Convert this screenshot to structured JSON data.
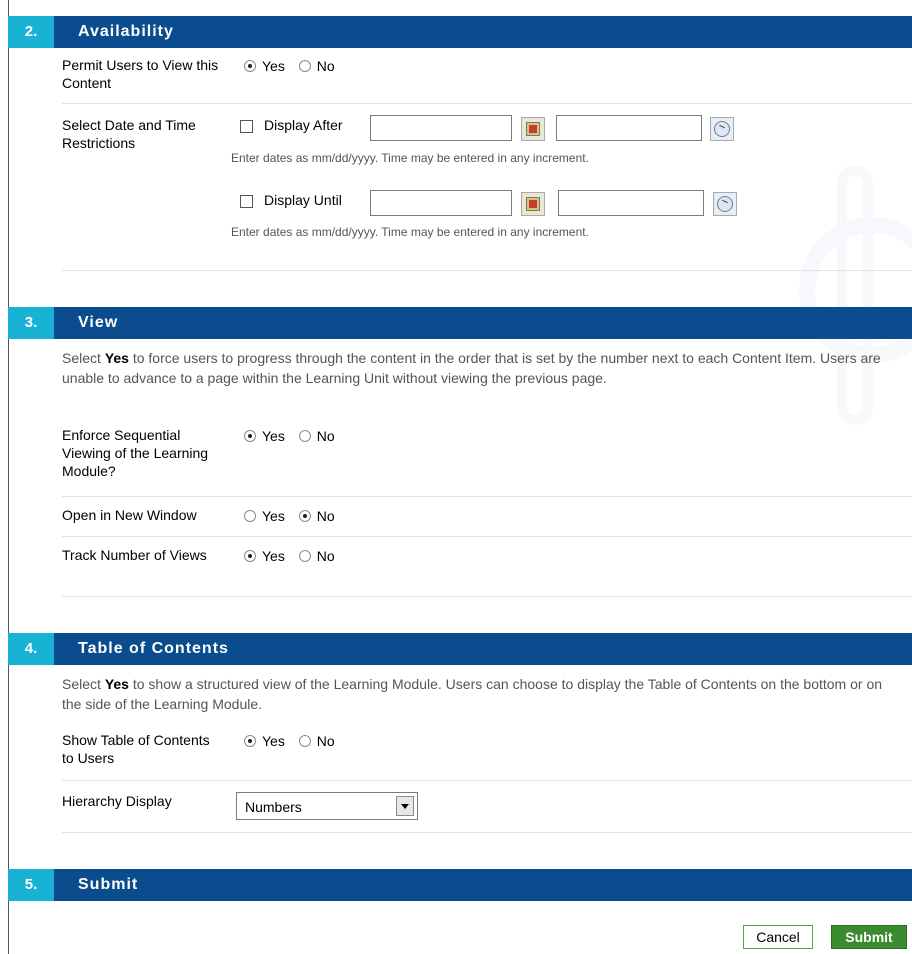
{
  "availability": {
    "num": "2.",
    "title": "Availability",
    "permit_label": "Permit Users to View this Content",
    "permit_value": "Yes",
    "date_restrictions_label": "Select Date and Time Restrictions",
    "display_after_label": "Display After",
    "display_until_label": "Display Until",
    "hint": "Enter dates as mm/dd/yyyy. Time may be entered in any increment."
  },
  "view": {
    "num": "3.",
    "title": "View",
    "desc_prefix": "Select ",
    "desc_bold": "Yes",
    "desc_rest": " to force users to progress through the content in the order that is set by the number next to each Content Item. Users are unable to advance to a page within the Learning Unit without viewing the previous page.",
    "sequential_label": "Enforce Sequential Viewing of the Learning Module?",
    "sequential_value": "Yes",
    "new_window_label": "Open in New Window",
    "new_window_value": "No",
    "track_label": "Track Number of Views",
    "track_value": "Yes"
  },
  "toc": {
    "num": "4.",
    "title": "Table of Contents",
    "desc_prefix": "Select ",
    "desc_bold": "Yes",
    "desc_rest": " to show a structured view of the Learning Module. Users can choose to display the Table of Contents on the bottom or on the side of the Learning Module.",
    "show_label": "Show Table of Contents to Users",
    "show_value": "Yes",
    "hierarchy_label": "Hierarchy Display",
    "hierarchy_value": "Numbers"
  },
  "submit": {
    "num": "5.",
    "title": "Submit",
    "cancel_label": "Cancel",
    "submit_label": "Submit"
  },
  "radio_options": {
    "yes": "Yes",
    "no": "No"
  },
  "colors": {
    "header_bg": "#0a4c8e",
    "number_bg": "#17b2d4",
    "submit_bg": "#3a8a2f"
  }
}
